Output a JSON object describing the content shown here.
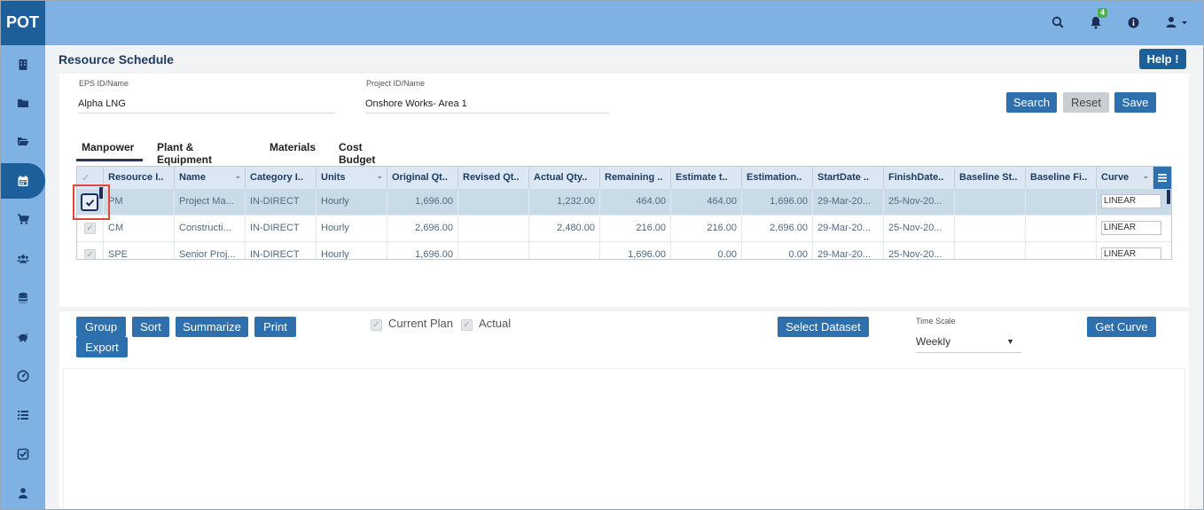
{
  "app": {
    "logo": "POT"
  },
  "topbar": {
    "icons": [
      "search-icon",
      "bell-icon",
      "info-icon",
      "user-icon"
    ],
    "notification_count": "4"
  },
  "sidebar": {
    "items": [
      "building-icon",
      "folder-icon",
      "folder-open-icon",
      "calendar-icon",
      "cart-icon",
      "users-icon",
      "database-icon",
      "piggy-bank-icon",
      "dashboard-icon",
      "list-icon",
      "checklist-icon",
      "person-icon"
    ],
    "active_index": 3
  },
  "page": {
    "title": "Resource Schedule",
    "help_label": "Help !"
  },
  "filters": {
    "eps_label": "EPS ID/Name",
    "eps_value": "Alpha LNG",
    "project_label": "Project ID/Name",
    "project_value": "Onshore  Works- Area 1",
    "search_label": "Search",
    "reset_label": "Reset",
    "save_label": "Save"
  },
  "tabs": [
    "Manpower",
    "Plant & Equipment",
    "Materials",
    "Cost Budget"
  ],
  "grid": {
    "columns": [
      "Resource I..",
      "Name",
      "Category I..",
      "Units",
      "Original Qt..",
      "Revised Qt..",
      "Actual Qty..",
      "Remaining ..",
      "Estimate t..",
      "Estimation..",
      "StartDate ..",
      "FinishDate..",
      "Baseline St..",
      "Baseline Fi..",
      "Curve"
    ],
    "rows": [
      {
        "id": "PM",
        "name": "Project Ma...",
        "category": "IN-DIRECT",
        "units": "Hourly",
        "original": "1,696.00",
        "revised": "",
        "actual": "1,232.00",
        "remaining": "464.00",
        "estimate": "464.00",
        "estimation": "1,696.00",
        "start": "29-Mar-20...",
        "finish": "25-Nov-20...",
        "bstart": "",
        "bfinish": "",
        "curve": "LINEAR"
      },
      {
        "id": "CM",
        "name": "Constructi...",
        "category": "IN-DIRECT",
        "units": "Hourly",
        "original": "2,696.00",
        "revised": "",
        "actual": "2,480.00",
        "remaining": "216.00",
        "estimate": "216.00",
        "estimation": "2,696.00",
        "start": "29-Mar-20...",
        "finish": "25-Nov-20...",
        "bstart": "",
        "bfinish": "",
        "curve": "LINEAR"
      },
      {
        "id": "SPE",
        "name": "Senior Proj...",
        "category": "IN-DIRECT",
        "units": "Hourly",
        "original": "1,696.00",
        "revised": "",
        "actual": "",
        "remaining": "1,696.00",
        "estimate": "0.00",
        "estimation": "0.00",
        "start": "29-Mar-20...",
        "finish": "25-Nov-20...",
        "bstart": "",
        "bfinish": "",
        "curve": "LINEAR"
      }
    ]
  },
  "toolbar": {
    "group_label": "Group",
    "sort_label": "Sort",
    "summarize_label": "Summarize",
    "print_label": "Print",
    "export_label": "Export",
    "current_plan_label": "Current Plan",
    "actual_label": "Actual",
    "select_dataset_label": "Select Dataset",
    "time_scale_label": "Time Scale",
    "time_scale_value": "Weekly",
    "get_curve_label": "Get Curve"
  }
}
